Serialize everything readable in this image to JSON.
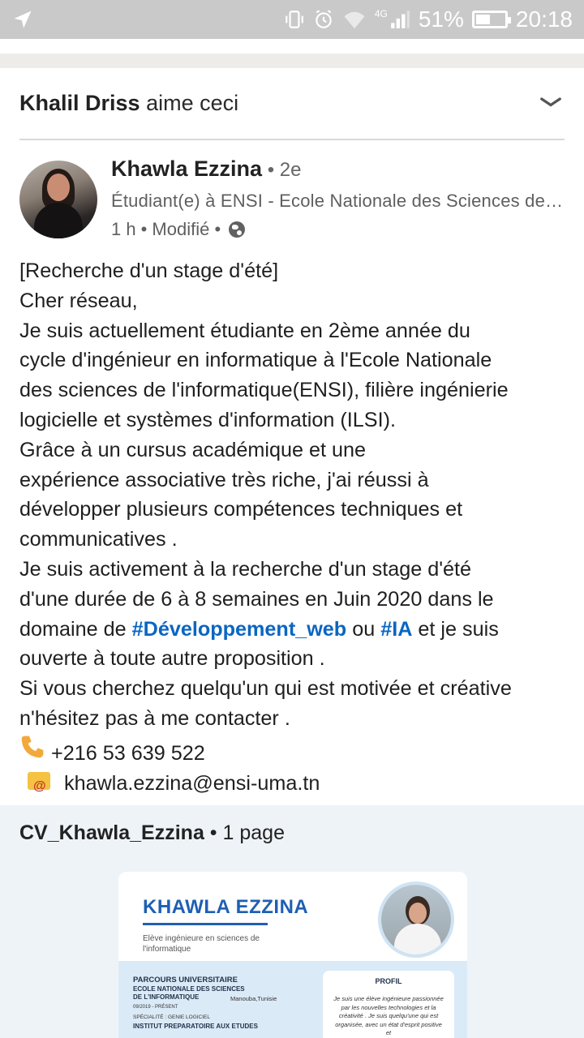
{
  "status_bar": {
    "battery_percent": "51%",
    "battery_level": 0.51,
    "time": "20:18",
    "network": "4G",
    "icons": [
      "send-icon",
      "vibrate-icon",
      "alarm-icon",
      "wifi-icon",
      "signal-icon",
      "battery-icon"
    ]
  },
  "activity_header": {
    "actor": "Khalil Driss",
    "action": " aime ceci"
  },
  "post": {
    "author": {
      "name": "Khawla Ezzina",
      "degree": " • 2e",
      "title": "Étudiant(e) à ENSI - Ecole Nationale des Sciences de l'Informatique",
      "time": "1 h",
      "edited": " • Modifié • "
    },
    "body": {
      "line1": "[Recherche d'un stage d'été]",
      "line2": "Cher réseau,",
      "line3": "Je suis actuellement étudiante en 2ème année du",
      "line4": "cycle d'ingénieur en informatique à l'Ecole Nationale",
      "line5": "des sciences de l'informatique(ENSI), filière ingénierie",
      "line6": "logicielle et systèmes d'information (ILSI).",
      "line7": "Grâce à un cursus académique et une",
      "line8": "expérience associative très riche, j'ai réussi à",
      "line9": "développer plusieurs compétences techniques et",
      "line10": "communicatives .",
      "line11": "Je suis activement à la recherche d'un stage d'été",
      "line12": "d'une durée de 6 à 8 semaines en Juin 2020 dans le",
      "line13_pre": "domaine de ",
      "hashtag1": "#Développement_web",
      "line13_mid": " ou ",
      "hashtag2": "#IA",
      "line13_post": " et je suis",
      "line14": "ouverte à toute autre proposition  .",
      "line15": "Si vous cherchez quelqu'un qui est motivée et créative",
      "line16": "n'hésitez pas à me contacter .",
      "phone": "+216 53 639 522",
      "email": "khawla.ezzina@ensi-uma.tn"
    }
  },
  "document": {
    "title": "CV_Khawla_Ezzina",
    "pages": " • 1 page",
    "preview": {
      "name": "KHAWLA EZZINA",
      "subtitle": "Elève ingénieure en sciences de l'informatique",
      "section_title": "PARCOURS UNIVERSITAIRE",
      "school": "ECOLE NATIONALE DES SCIENCES DE L'INFORMATIQUE",
      "location": "Manouba,Tunisie",
      "dates": "09/2019 - PRÉSENT",
      "specialty": "SPÉCIALITÉ : GENIE LOGICIEL",
      "prep": "INSTITUT PREPARATOIRE AUX ETUDES",
      "profile_title": "PROFIL",
      "profile_text": "Je suis une élève ingénieure passionnée par les nouvelles technologies et la créativité . Je suis quelqu'une qui est organisée, avec un état d'esprit positive et"
    }
  }
}
